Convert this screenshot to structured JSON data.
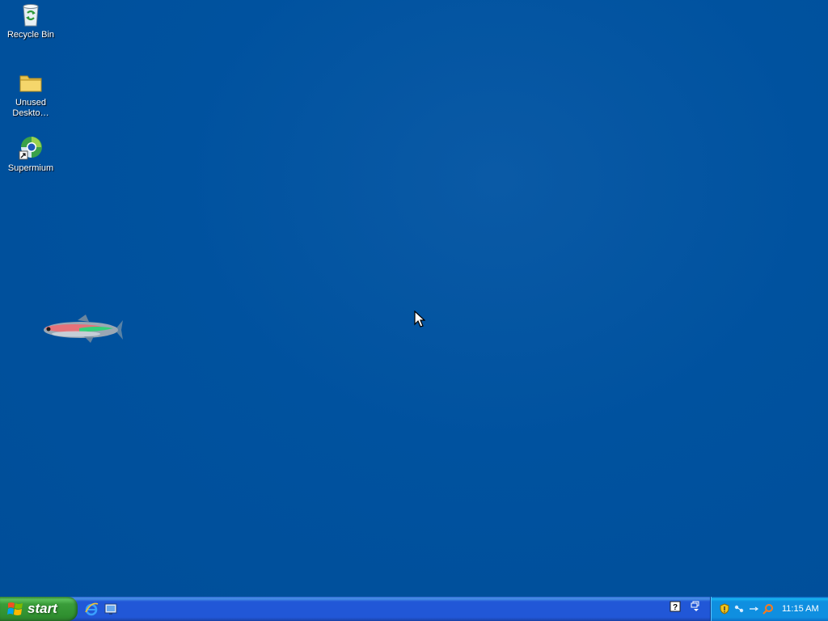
{
  "desktop": {
    "icons": [
      {
        "label": "Recycle Bin",
        "icon": "recycle-bin-icon"
      },
      {
        "label": "Unused Deskto…",
        "icon": "folder-icon"
      },
      {
        "label": "Supermium",
        "icon": "supermium-browser-icon"
      }
    ],
    "wallpaper": {
      "decoration": "fish-icon",
      "color": "#00519e"
    }
  },
  "taskbar": {
    "start_label": "start",
    "quick_launch": [
      "internet-explorer-icon",
      "show-desktop-icon"
    ],
    "tray_left": [
      "help-icon",
      "restore-icon"
    ],
    "tray_icons": [
      "security-shield-icon",
      "network-icon",
      "volume-icon",
      "search-icon"
    ],
    "clock": "11:15 AM"
  },
  "colors": {
    "taskbar_blue": "#2157d7",
    "start_green": "#3a9d3a",
    "tray_blue": "#0f8fe0"
  }
}
